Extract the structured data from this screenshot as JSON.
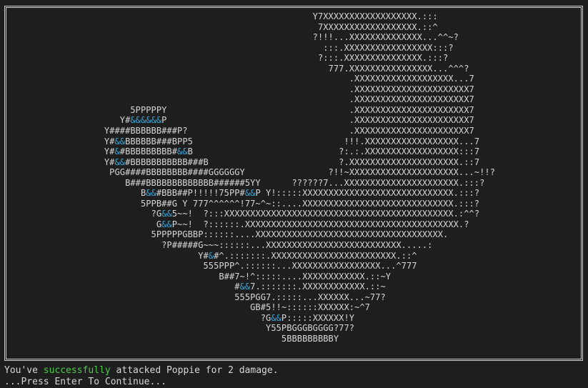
{
  "ascii_art": {
    "lines": [
      "                                                            Y7XXXXXXXXXXXXXXXXXX.:::",
      "                                                             7XXXXXXXXXXXXXXXXXX.::^",
      "                                                            ?!!!...XXXXXXXXXXXXXX...^^~?",
      "                                                              :::.XXXXXXXXXXXXXXXXX:::?",
      "                                                             ?:::.XXXXXXXXXXXXXXX.:::?",
      "                                                               777.XXXXXXXXXXXXXXXX...^^^?",
      "                                                                   .XXXXXXXXXXXXXXXXXXX...7",
      "                                                                   .XXXXXXXXXXXXXXXXXXXXXX7",
      "                                                                   .XXXXXXXXXXXXXXXXXXXXXX7",
      "                         5PPPPPY                                   .XXXXXXXXXXXXXXXXXXXXXX7",
      "                       Y#&&&&&&P                                   .XXXXXXXXXXXXXXXXXXXXXX7",
      "                    Y####BBBBBB###P?                               .XXXXXXXXXXXXXXXXXXXXXX7",
      "                    Y#&&BBBBBB###BPP5                             !!!.XXXXXXXXXXXXXXXXXX...7",
      "                    Y#&#BBBBBBBBB#&&B                            ?:.:.XXXXXXXXXXXXXXXXXX:::7",
      "                    Y#&&#BBBBBBBBBBB###B                         ?.XXXXXXXXXXXXXXXXXXXXX.::7",
      "                     PGG####BBBBBBBB####GGGGGGY                ?!!~XXXXXXXXXXXXXXXXXXXXX...~!!?",
      "                        B###BBBBBBBBBBBBB######5YY      ??????7...XXXXXXXXXXXXXXXXXXXXXX.:::?",
      "                           B&&#BBB##P!!!!!75PP#&&P Y!:::::XXXXXXXXXXXXXXXXXXXXXXXXXXXXX.:::?",
      "                           5PPB##G Y 777^^^^^^!77~^~::....XXXXXXXXXXXXXXXXXXXXXXXXXXXXX.:::?",
      "                             ?G&&5~~!  ?:::XXXXXXXXXXXXXXXXXXXXXXXXXXXXXXXXXXXXXXXXXXXX.:^^?",
      "                              G&&P~~!  ?::::::.XXXXXXXXXXXXXXXXXXXXXXXXXXXXXXXXXXXXXXXXX.?",
      "                             5PPPPPGBBP::::::....XXXXXXXXXXXXXXXXXXXXXXXXXXXXXXXXXXXX.",
      "                               ?P#####G~~~::::::...XXXXXXXXXXXXXXXXXXXXXXXXXX.....:",
      "                                      Y#&#^.:::::::.XXXXXXXXXXXXXXXXXXXXXXXX.::^",
      "                                       555PPP^.::::::...XXXXXXXXXXXXXXXXX...^777",
      "                                          B##7~!^:::::....XXXXXXXXXXXX.::~Y",
      "                                             #&&7.:::::::.XXXXXXXXXXXX.::~",
      "                                             555PGG7.:::::...XXXXXX...~77?",
      "                                                GB#5!!~::::::XXXXXX:~^7",
      "                                                  ?G&&P:::::XXXXXX!Y",
      "                                                   Y55PBGGGBGGGG?77?",
      "                                                      5BBBBBBBBBY"
    ]
  },
  "message": {
    "prefix": "You've ",
    "highlight": "successfully",
    "suffix": " attacked Poppie for 2 damage."
  },
  "prompt": {
    "text": "...Press Enter To Continue..."
  },
  "colors": {
    "background": "#1e1e1e",
    "foreground": "#d6d6d6",
    "highlight_amp": "#3aa6d8",
    "success": "#4ec94e",
    "frame": "#cfcfcf"
  }
}
